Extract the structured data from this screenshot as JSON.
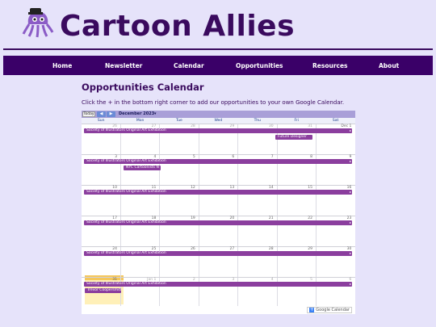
{
  "site": {
    "title": "Cartoon Allies"
  },
  "nav": [
    {
      "label": "Home"
    },
    {
      "label": "Newsletter"
    },
    {
      "label": "Calendar"
    },
    {
      "label": "Opportunities"
    },
    {
      "label": "Resources"
    },
    {
      "label": "About"
    }
  ],
  "page": {
    "heading": "Opportunities Calendar",
    "intro": "Click the + in the bottom right corner to add our opportunities to your own Google Calendar."
  },
  "calendar": {
    "today_label": "Today",
    "prev_icon": "◀",
    "next_icon": "▶",
    "month_label": "December 2023",
    "month_caret": "▾",
    "weekdays": [
      "Sun",
      "Mon",
      "Tue",
      "Wed",
      "Thu",
      "Fri",
      "Sat"
    ],
    "weeks": [
      {
        "days": [
          "26",
          "27",
          "28",
          "29",
          "30",
          "31",
          "Dec 1"
        ],
        "dim": [
          true,
          true,
          true,
          true,
          true,
          true,
          false
        ],
        "extra_day": "2"
      },
      {
        "days": [
          "3",
          "4",
          "5",
          "6",
          "7",
          "8",
          "9"
        ]
      },
      {
        "days": [
          "10",
          "11",
          "12",
          "13",
          "14",
          "15",
          "16"
        ]
      },
      {
        "days": [
          "17",
          "18",
          "19",
          "20",
          "21",
          "22",
          "23"
        ]
      },
      {
        "days": [
          "24",
          "25",
          "26",
          "27",
          "28",
          "29",
          "30"
        ]
      },
      {
        "days": [
          "31",
          "Jan 1",
          "2",
          "3",
          "4",
          "5",
          "6"
        ]
      }
    ],
    "events": {
      "recurring": "Society of Illustrators Original Art Exhibition",
      "future_designer": "Future Designer",
      "nyc_cartoonists": "NYC Cartoonists N",
      "trevor": "Trevor Coopersmith"
    },
    "footer_button": "Google Calendar",
    "footer_plus": "+"
  },
  "colors": {
    "accent": "#3a0068",
    "event": "#8b3e9e",
    "background": "#e6e3fa"
  }
}
